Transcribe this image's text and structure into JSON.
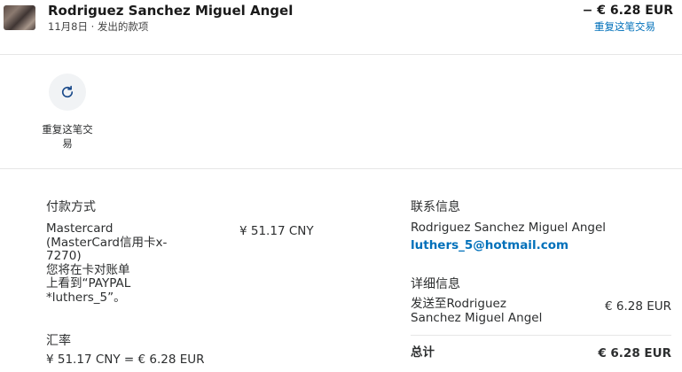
{
  "header": {
    "name": "Rodriguez Sanchez Miguel Angel",
    "subtitle": "11月8日 · 发出的款项",
    "amount": "− € 6.28 EUR",
    "repeat_link": "重复这笔交易"
  },
  "actions": {
    "repeat_label": "重复这笔交易"
  },
  "payment": {
    "heading": "付款方式",
    "method_line1": "Mastercard",
    "method_line2": "(MasterCard信用卡x-",
    "method_line3": "7270)",
    "method_line4": "您将在卡对账单",
    "method_line5": "上看到“PAYPAL",
    "method_line6": "*luthers_5”。",
    "amount": "¥ 51.17 CNY"
  },
  "exchange": {
    "heading": "汇率",
    "value": "¥ 51.17 CNY = € 6.28 EUR"
  },
  "contact": {
    "heading": "联系信息",
    "name": "Rodriguez Sanchez Miguel Angel",
    "email": "luthers_5@hotmail.com"
  },
  "details": {
    "heading": "详细信息",
    "sent_to_line1": "发送至Rodriguez",
    "sent_to_line2": "Sanchez Miguel Angel",
    "sent_amount": "€ 6.28 EUR",
    "total_label": "总计",
    "total_amount": "€ 6.28 EUR"
  }
}
